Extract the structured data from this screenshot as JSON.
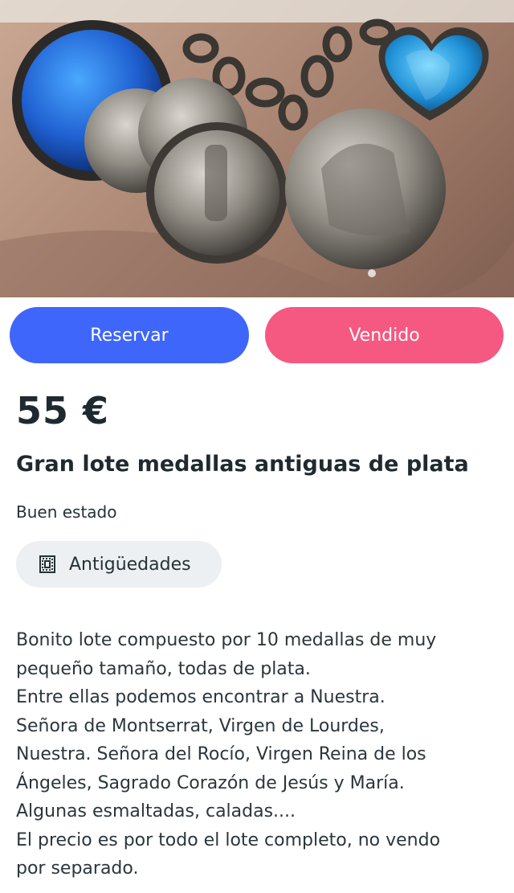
{
  "listing": {
    "image": {
      "alt_icon": "product-photo",
      "pager_dots": 1
    },
    "actions": {
      "reserve_label": "Reservar",
      "sold_label": "Vendido"
    },
    "price": "55 €",
    "title": "Gran lote medallas antiguas de plata",
    "condition": "Buen estado",
    "category": {
      "icon": "category-icon",
      "label": "Antigüedades"
    },
    "description_lines": [
      "Bonito lote compuesto por 10 medallas de muy",
      "pequeño tamaño, todas de plata.",
      "Entre ellas podemos encontrar a Nuestra.",
      "Señora de Montserrat, Virgen de Lourdes,",
      "Nuestra. Señora del Rocío, Virgen Reina de los",
      "Ángeles, Sagrado Corazón de Jesús y María.",
      "Algunas esmaltadas, caladas....",
      "El precio es por todo el lote completo, no vendo",
      "por separado."
    ]
  },
  "colors": {
    "reserve_button": "#3f66fb",
    "sold_button": "#f55881",
    "category_chip": "#ecf0f2",
    "text": "#253238"
  }
}
